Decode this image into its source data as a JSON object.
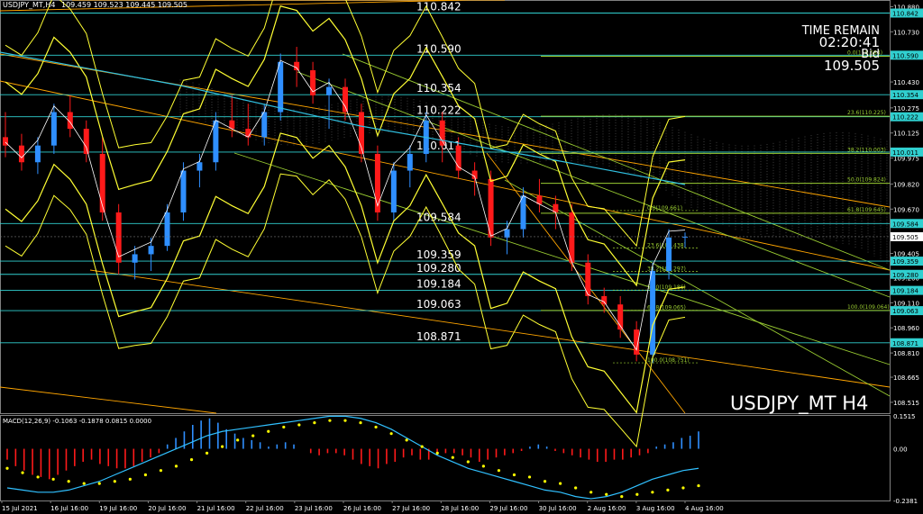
{
  "header": {
    "symbol": "USDJPY_MT,H4",
    "ohlc": "109.459 109.523 109.445 109.505"
  },
  "info_panel": {
    "time_remain_label": "TIME REMAIN",
    "time_remain": "02:20:41",
    "bid_label": "Bid",
    "bid_value": "109.505"
  },
  "watermark": "USDJPY_MT H4",
  "colors": {
    "background": "#000000",
    "bull_candle": "#2f8fff",
    "bear_candle": "#ff1a1a",
    "bollinger": "#ffff33",
    "level_line": "#30d0d0",
    "fibo_line": "#9acd32",
    "channel_line": "#ffa500",
    "macd_line": "#30c0ff",
    "signal_dots": "#ffff00"
  },
  "price_levels": [
    {
      "label": "110.842",
      "price": 110.842
    },
    {
      "label": "110.590",
      "price": 110.59
    },
    {
      "label": "110.354",
      "price": 110.354
    },
    {
      "label": "110.222",
      "price": 110.222
    },
    {
      "label": "110.011",
      "price": 110.011
    },
    {
      "label": "109.584",
      "price": 109.584
    },
    {
      "label": "109.359",
      "price": 109.359
    },
    {
      "label": "109.280",
      "price": 109.28
    },
    {
      "label": "109.184",
      "price": 109.184
    },
    {
      "label": "109.063",
      "price": 109.063
    },
    {
      "label": "108.871",
      "price": 108.871
    }
  ],
  "fibo_right_labels": [
    {
      "label": "0.0(110.584)",
      "price": 110.584
    },
    {
      "label": "23.6(110.225)",
      "price": 110.225
    },
    {
      "label": "38.2(110.003)",
      "price": 110.003
    },
    {
      "label": "50.0(109.824)",
      "price": 109.824
    },
    {
      "label": "61.8(109.645)",
      "price": 109.645
    },
    {
      "label": "100.0(109.064)",
      "price": 109.064
    }
  ],
  "fibo_small_labels": [
    {
      "label": "0.0(109.661)",
      "price": 109.661
    },
    {
      "label": "23.6(109.438)",
      "price": 109.438
    },
    {
      "label": "38.2(109.297)",
      "price": 109.297
    },
    {
      "label": "50.0(109.186)",
      "price": 109.186
    },
    {
      "label": "61.8(109.065)",
      "price": 109.065
    },
    {
      "label": "100.0(108.751)",
      "price": 108.751
    }
  ],
  "price_axis_ticks": [
    "110.880",
    "110.730",
    "110.580",
    "110.430",
    "110.275",
    "110.125",
    "109.975",
    "109.820",
    "109.670",
    "109.520",
    "109.405",
    "109.260",
    "109.110",
    "108.960",
    "108.810",
    "108.665",
    "108.515"
  ],
  "price_axis_tick_values": [
    110.88,
    110.73,
    110.58,
    110.43,
    110.275,
    110.125,
    109.975,
    109.82,
    109.67,
    109.52,
    109.405,
    109.26,
    109.11,
    108.96,
    108.81,
    108.665,
    108.515
  ],
  "bid_axis_label": "109.505",
  "macd": {
    "label": "MACD(12,26,9) -0.1063 -0.1878 0.0815 0.0000",
    "axis_ticks": [
      "0.1515",
      "0.00",
      "-0.2381"
    ],
    "axis_tick_values": [
      0.1515,
      0.0,
      -0.2381
    ],
    "histogram": [
      -0.05,
      -0.08,
      -0.1,
      -0.12,
      -0.13,
      -0.14,
      -0.12,
      -0.1,
      -0.08,
      -0.06,
      -0.05,
      -0.07,
      -0.08,
      -0.09,
      -0.09,
      -0.08,
      -0.06,
      -0.04,
      -0.02,
      0.02,
      0.05,
      0.08,
      0.11,
      0.13,
      0.14,
      0.12,
      0.09,
      0.07,
      0.05,
      0.04,
      0.03,
      0.01,
      0.02,
      0.03,
      0.02,
      0.0,
      -0.02,
      -0.03,
      -0.02,
      -0.02,
      -0.03,
      -0.05,
      -0.07,
      -0.08,
      -0.09,
      -0.07,
      -0.06,
      -0.04,
      -0.03,
      -0.05,
      -0.05,
      -0.03,
      -0.02,
      -0.02,
      -0.03,
      -0.04,
      -0.06,
      -0.05,
      -0.04,
      -0.03,
      -0.02,
      -0.01,
      0.01,
      0.02,
      0.01,
      -0.01,
      -0.02,
      -0.03,
      -0.04,
      -0.05,
      -0.06,
      -0.06,
      -0.05,
      -0.05,
      -0.04,
      -0.03,
      -0.02,
      0.01,
      0.02,
      0.03,
      0.05,
      0.06,
      0.08
    ],
    "line": [
      -0.18,
      -0.19,
      -0.2,
      -0.2,
      -0.19,
      -0.17,
      -0.15,
      -0.12,
      -0.09,
      -0.06,
      -0.03,
      0.0,
      0.03,
      0.06,
      0.08,
      0.09,
      0.1,
      0.11,
      0.12,
      0.13,
      0.14,
      0.15,
      0.15,
      0.14,
      0.12,
      0.09,
      0.05,
      0.01,
      -0.03,
      -0.06,
      -0.09,
      -0.11,
      -0.13,
      -0.15,
      -0.17,
      -0.19,
      -0.2,
      -0.22,
      -0.23,
      -0.22,
      -0.2,
      -0.17,
      -0.14,
      -0.12,
      -0.1,
      -0.09
    ],
    "signal": [
      -0.09,
      -0.11,
      -0.13,
      -0.14,
      -0.15,
      -0.16,
      -0.16,
      -0.15,
      -0.14,
      -0.12,
      -0.1,
      -0.08,
      -0.05,
      -0.02,
      0.01,
      0.04,
      0.06,
      0.08,
      0.1,
      0.11,
      0.12,
      0.13,
      0.13,
      0.12,
      0.1,
      0.07,
      0.04,
      0.01,
      -0.02,
      -0.04,
      -0.06,
      -0.08,
      -0.1,
      -0.12,
      -0.13,
      -0.15,
      -0.16,
      -0.18,
      -0.2,
      -0.21,
      -0.22,
      -0.21,
      -0.2,
      -0.19,
      -0.18,
      -0.17
    ]
  },
  "time_axis": [
    "15 Jul 2021",
    "16 Jul 16:00",
    "19 Jul 16:00",
    "20 Jul 16:00",
    "21 Jul 16:00",
    "22 Jul 16:00",
    "23 Jul 16:00",
    "26 Jul 16:00",
    "27 Jul 16:00",
    "28 Jul 16:00",
    "29 Jul 16:00",
    "30 Jul 16:00",
    "2 Aug 16:00",
    "3 Aug 16:00",
    "4 Aug 16:00"
  ],
  "chart_data": {
    "type": "candlestick",
    "symbol": "USDJPY_MT",
    "timeframe": "H4",
    "ylim": [
      108.45,
      110.92
    ],
    "candles": [
      [
        110.1,
        110.25,
        109.98,
        110.05
      ],
      [
        110.05,
        110.12,
        109.9,
        109.95
      ],
      [
        109.95,
        110.1,
        109.88,
        110.05
      ],
      [
        110.05,
        110.3,
        110.0,
        110.25
      ],
      [
        110.25,
        110.35,
        110.1,
        110.15
      ],
      [
        110.15,
        110.2,
        109.95,
        110.0
      ],
      [
        110.0,
        110.1,
        109.6,
        109.65
      ],
      [
        109.65,
        109.7,
        109.28,
        109.35
      ],
      [
        109.35,
        109.45,
        109.25,
        109.4
      ],
      [
        109.4,
        109.5,
        109.3,
        109.45
      ],
      [
        109.45,
        109.7,
        109.42,
        109.65
      ],
      [
        109.65,
        109.95,
        109.6,
        109.9
      ],
      [
        109.9,
        110.0,
        109.8,
        109.95
      ],
      [
        109.95,
        110.25,
        109.9,
        110.2
      ],
      [
        110.2,
        110.35,
        110.1,
        110.15
      ],
      [
        110.15,
        110.3,
        110.05,
        110.1
      ],
      [
        110.1,
        110.3,
        110.05,
        110.25
      ],
      [
        110.25,
        110.6,
        110.2,
        110.55
      ],
      [
        110.55,
        110.64,
        110.4,
        110.5
      ],
      [
        110.5,
        110.55,
        110.3,
        110.35
      ],
      [
        110.35,
        110.45,
        110.15,
        110.4
      ],
      [
        110.4,
        110.45,
        110.2,
        110.25
      ],
      [
        110.25,
        110.3,
        109.95,
        110.0
      ],
      [
        110.0,
        110.05,
        109.6,
        109.65
      ],
      [
        109.65,
        109.95,
        109.6,
        109.9
      ],
      [
        109.9,
        110.05,
        109.8,
        110.0
      ],
      [
        110.0,
        110.25,
        109.95,
        110.2
      ],
      [
        110.2,
        110.25,
        109.95,
        110.05
      ],
      [
        110.05,
        110.1,
        109.85,
        109.9
      ],
      [
        109.9,
        109.95,
        109.75,
        109.85
      ],
      [
        109.85,
        109.9,
        109.45,
        109.5
      ],
      [
        109.5,
        109.6,
        109.4,
        109.55
      ],
      [
        109.55,
        109.8,
        109.5,
        109.75
      ],
      [
        109.75,
        109.85,
        109.65,
        109.7
      ],
      [
        109.7,
        109.75,
        109.55,
        109.65
      ],
      [
        109.65,
        109.7,
        109.3,
        109.35
      ],
      [
        109.35,
        109.4,
        109.1,
        109.15
      ],
      [
        109.15,
        109.2,
        109.05,
        109.1
      ],
      [
        109.1,
        109.15,
        108.9,
        108.95
      ],
      [
        108.95,
        109.0,
        108.76,
        108.8
      ],
      [
        108.8,
        109.35,
        108.75,
        109.3
      ],
      [
        109.3,
        109.55,
        109.25,
        109.5
      ],
      [
        109.5,
        109.53,
        109.44,
        109.505
      ]
    ]
  }
}
